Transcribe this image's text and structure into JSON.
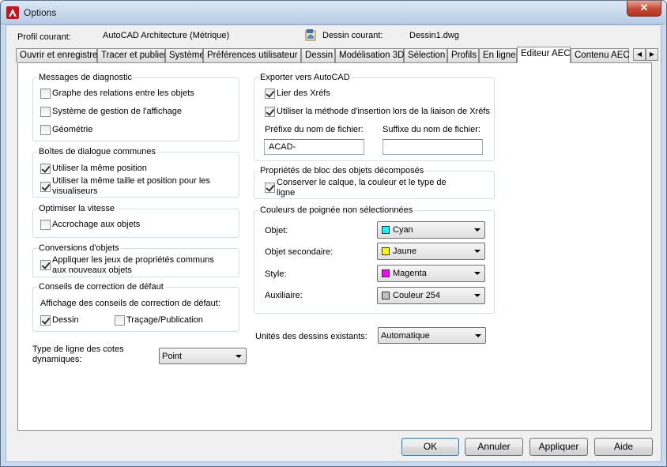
{
  "window": {
    "title": "Options",
    "close_glyph": "✕"
  },
  "header": {
    "profile_label": "Profil courant:",
    "profile_value": "AutoCAD Architecture (Métrique)",
    "drawing_label": "Dessin courant:",
    "drawing_value": "Dessin1.dwg"
  },
  "tabs": [
    {
      "label": "Ouvrir et enregistrer"
    },
    {
      "label": "Tracer et publier"
    },
    {
      "label": "Système"
    },
    {
      "label": "Préférences utilisateur"
    },
    {
      "label": "Dessin"
    },
    {
      "label": "Modélisation 3D"
    },
    {
      "label": "Sélection"
    },
    {
      "label": "Profils"
    },
    {
      "label": "En ligne"
    },
    {
      "label": "Editeur AEC",
      "active": true
    },
    {
      "label": "Contenu AEC"
    }
  ],
  "tab_scroll": {
    "left": "◀",
    "right": "▶"
  },
  "diagnostic": {
    "title": "Messages de diagnostic",
    "items": [
      {
        "label": "Graphe des relations entre les objets",
        "checked": false
      },
      {
        "label": "Système de gestion de l'affichage",
        "checked": false
      },
      {
        "label": "Géométrie",
        "checked": false
      }
    ]
  },
  "dialogs": {
    "title": "Boîtes de dialogue communes",
    "items": [
      {
        "label": "Utiliser la même position",
        "checked": true
      },
      {
        "label": "Utiliser la même taille et position pour les visualiseurs",
        "checked": true
      }
    ]
  },
  "speed": {
    "title": "Optimiser la vitesse",
    "items": [
      {
        "label": "Accrochage aux objets",
        "checked": false
      }
    ]
  },
  "conversions": {
    "title": "Conversions d'objets",
    "items": [
      {
        "label": "Appliquer les jeux de propriétés communs aux nouveaux objets",
        "checked": true
      }
    ]
  },
  "tips": {
    "title": "Conseils de correction de défaut",
    "subtitle": "Affichage des conseils de correction de défaut:",
    "items": [
      {
        "label": "Dessin",
        "checked": true
      },
      {
        "label": "Traçage/Publication",
        "checked": false
      }
    ]
  },
  "dimline": {
    "label": "Type de ligne des cotes dynamiques:",
    "value": "Point"
  },
  "export": {
    "title": "Exporter vers AutoCAD",
    "items": [
      {
        "label": "Lier des Xréfs",
        "checked": true
      },
      {
        "label": "Utiliser la méthode d'insertion lors de la liaison de Xréfs",
        "checked": true
      }
    ],
    "prefix_label": "Préfixe du nom de fichier:",
    "prefix_value": "ACAD-",
    "suffix_label": "Suffixe du nom de fichier:",
    "suffix_value": ""
  },
  "block": {
    "title": "Propriétés de bloc des objets décomposés",
    "items": [
      {
        "label": "Conserver le calque, la couleur et le type de ligne",
        "checked": true
      }
    ]
  },
  "grips": {
    "title": "Couleurs de poignée non sélectionnées",
    "rows": [
      {
        "label": "Objet:",
        "value": "Cyan",
        "color": "#00ffff"
      },
      {
        "label": "Objet secondaire:",
        "value": "Jaune",
        "color": "#ffff00"
      },
      {
        "label": "Style:",
        "value": "Magenta",
        "color": "#ff00ff"
      },
      {
        "label": "Auxiliaire:",
        "value": "Couleur 254",
        "color": "#c0c0c0"
      }
    ]
  },
  "units": {
    "label": "Unités des dessins existants:",
    "value": "Automatique"
  },
  "buttons": {
    "ok": "OK",
    "cancel": "Annuler",
    "apply": "Appliquer",
    "help": "Aide"
  }
}
